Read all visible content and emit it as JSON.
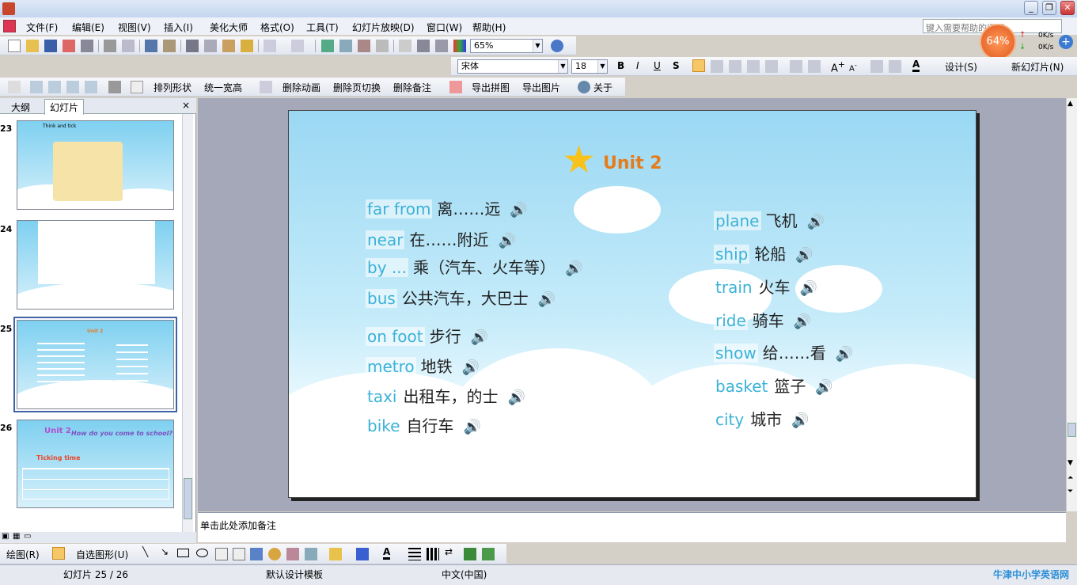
{
  "menu": [
    "文件(F)",
    "编辑(E)",
    "视图(V)",
    "插入(I)",
    "美化大师",
    "格式(O)",
    "工具(T)",
    "幻灯片放映(D)",
    "窗口(W)",
    "帮助(H)"
  ],
  "help_placeholder": "键入需要帮助的问题",
  "zoom": "65%",
  "net": {
    "percent": "64%",
    "up": "0K/s",
    "down": "0K/s"
  },
  "format": {
    "font": "宋体",
    "size": "18",
    "design": "设计(S)",
    "new_slide": "新幻灯片(N)"
  },
  "toolbar3": [
    "排列形状",
    "统一宽高",
    "删除动画",
    "删除页切换",
    "删除备注",
    "导出拼图",
    "导出图片",
    "关于"
  ],
  "panel": {
    "tab_outline": "大纲",
    "tab_slides": "幻灯片",
    "close": "×"
  },
  "thumbs": [
    {
      "num": "23",
      "title": "Think and tick"
    },
    {
      "num": "24"
    },
    {
      "num": "25",
      "title": "Unit 2"
    },
    {
      "num": "26",
      "title": "Unit 2",
      "subtitle": "How do you come to school?",
      "badge": "Ticking time"
    }
  ],
  "slide": {
    "title": "Unit 2",
    "left": [
      {
        "en": "far from",
        "zh": "离……远"
      },
      {
        "en": "near",
        "zh": "在……附近"
      },
      {
        "en": "by ...",
        "zh": "乘（汽车、火车等）"
      },
      {
        "en": "bus",
        "zh": "公共汽车，大巴士"
      },
      {
        "en": "on foot",
        "zh": "步行"
      },
      {
        "en": "metro",
        "zh": "地铁"
      },
      {
        "en": "taxi",
        "zh": "出租车，的士"
      },
      {
        "en": "bike",
        "zh": "自行车"
      }
    ],
    "right": [
      {
        "en": "plane",
        "zh": "飞机"
      },
      {
        "en": "ship",
        "zh": "轮船"
      },
      {
        "en": "train",
        "zh": "火车"
      },
      {
        "en": "ride",
        "zh": "骑车"
      },
      {
        "en": "show",
        "zh": "给……看"
      },
      {
        "en": "basket",
        "zh": "篮子"
      },
      {
        "en": "city",
        "zh": "城市"
      }
    ]
  },
  "notes_placeholder": "单击此处添加备注",
  "drawing": {
    "draw": "绘图(R)",
    "autoshapes": "自选图形(U)"
  },
  "status": {
    "slide": "幻灯片 25 / 26",
    "template": "默认设计模板",
    "lang": "中文(中国)",
    "watermark": "牛津中小学英语网"
  }
}
